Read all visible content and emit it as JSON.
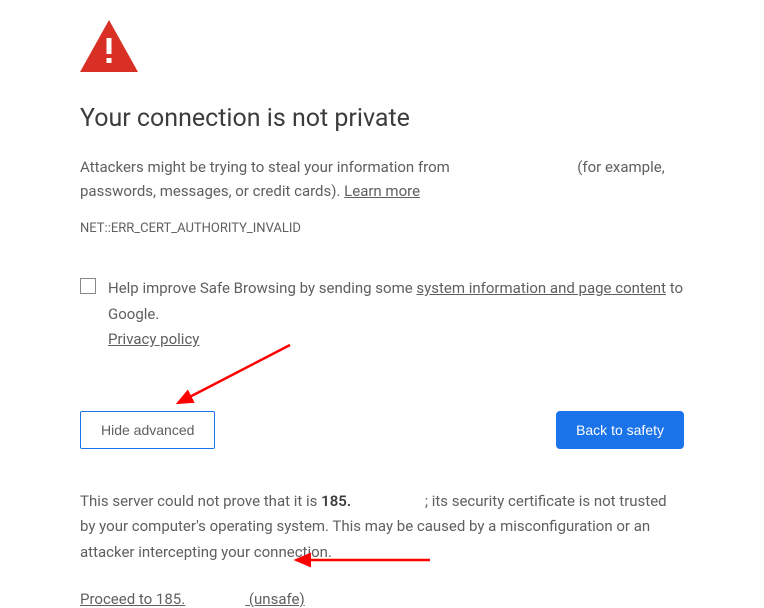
{
  "colors": {
    "danger": "#d93025",
    "primary": "#1a73e8"
  },
  "heading": "Your connection is not private",
  "warn_prefix": "Attackers might be trying to steal your information from ",
  "warn_host_masked": " ",
  "warn_suffix": " (for example, passwords, messages, or credit cards). ",
  "learn_more": "Learn more",
  "error_code": "NET::ERR_CERT_AUTHORITY_INVALID",
  "optin_prefix": "Help improve Safe Browsing by sending some ",
  "optin_link": "system information and page content",
  "optin_suffix": " to Google. ",
  "privacy_policy": "Privacy policy",
  "hide_advanced": "Hide advanced",
  "back_to_safety": "Back to safety",
  "adv_prefix": "This server could not prove that it is ",
  "adv_host_bold": "185.",
  "adv_suffix": " ; its security certificate is not trusted by your computer's operating system. This may be caused by a misconfiguration or an attacker intercepting your connection.",
  "proceed_prefix": "Proceed to 185.",
  "proceed_host_masked": " ",
  "proceed_suffix": " (unsafe)"
}
